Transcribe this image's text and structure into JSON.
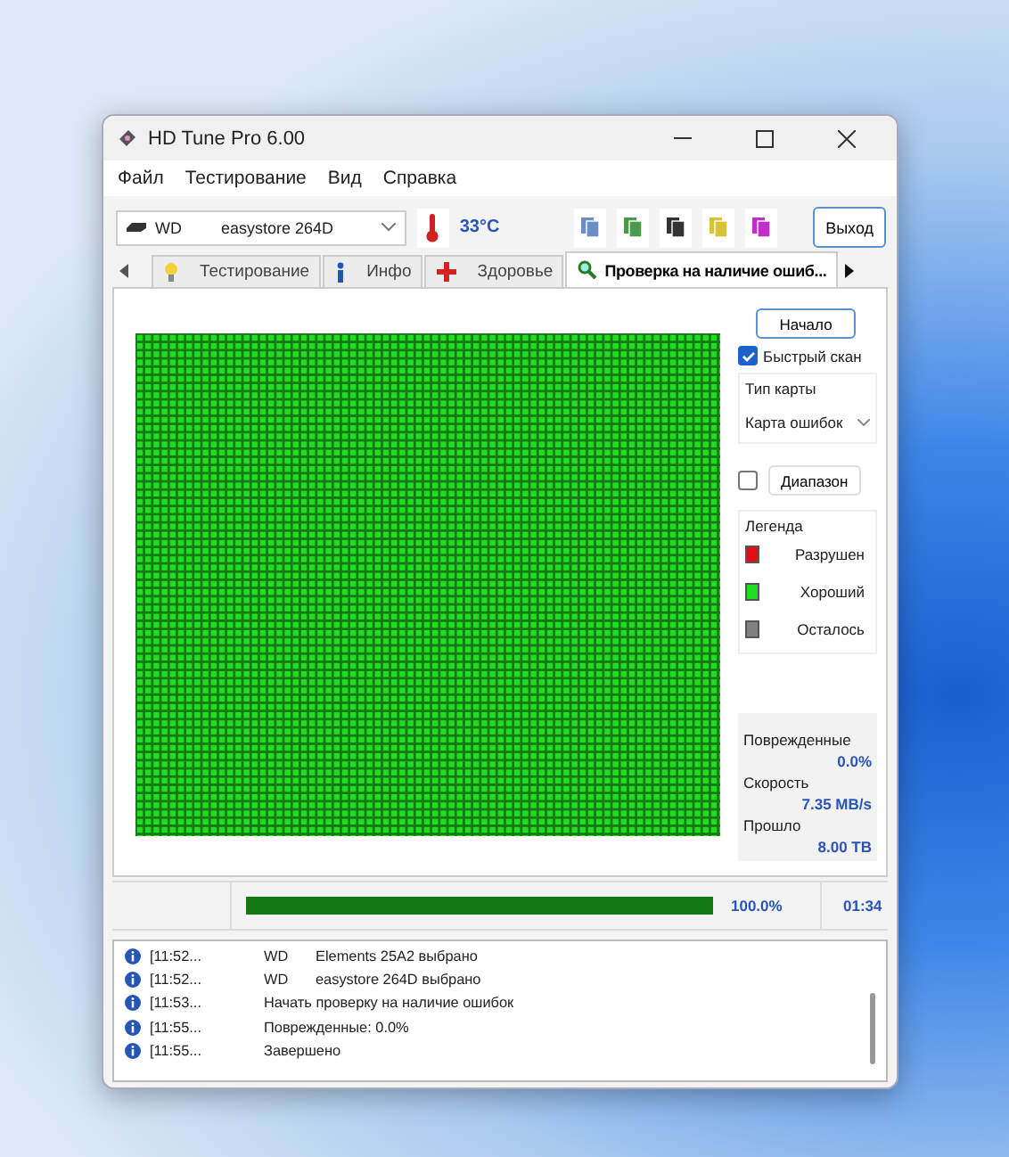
{
  "window": {
    "title": "HD Tune Pro 6.00"
  },
  "menu": [
    "Файл",
    "Тестирование",
    "Вид",
    "Справка"
  ],
  "drive": {
    "brand": "WD",
    "model": "easystore 264D"
  },
  "temperature": "33°C",
  "exit_button": "Выход",
  "tabs": [
    {
      "label": "Тестирование",
      "selected": false,
      "kind": "bulb"
    },
    {
      "label": "Инфо",
      "selected": false,
      "kind": "info"
    },
    {
      "label": "Здоровье",
      "selected": false,
      "kind": "cross"
    },
    {
      "label": "Проверка на наличие ошиб...",
      "selected": true,
      "kind": "magnifier"
    }
  ],
  "side": {
    "start_button": "Начало",
    "quick_scan": {
      "label": "Быстрый скан",
      "checked": true
    },
    "map_type": {
      "label": "Тип карты",
      "value": "Карта ошибок"
    },
    "range": {
      "label": "Диапазон",
      "checked": false
    },
    "legend": {
      "title": "Легенда",
      "items": [
        {
          "label": "Разрушен",
          "color": "#e01010"
        },
        {
          "label": "Хороший",
          "color": "#22dd22"
        },
        {
          "label": "Осталось",
          "color": "#808080"
        }
      ]
    },
    "stats": [
      {
        "label": "Поврежденные",
        "value": "0.0%"
      },
      {
        "label": "Скорость",
        "value": "7.35 MB/s"
      },
      {
        "label": "Прошло",
        "value": "8.00 TB"
      }
    ]
  },
  "progress": {
    "level": 1,
    "reading": "100.0%",
    "time": "01:34"
  },
  "log": [
    {
      "time": "[11:52...",
      "source": "WD",
      "message": "Elements 25A2 выбрано"
    },
    {
      "time": "[11:52...",
      "source": "WD",
      "message": "easystore 264D выбрано"
    },
    {
      "time": "[11:53...",
      "message": "Начать проверку на наличие ошибок"
    },
    {
      "time": "[11:55...",
      "message": "Поврежденные: 0.0%"
    },
    {
      "time": "[11:55...",
      "message": "Завершено"
    }
  ]
}
